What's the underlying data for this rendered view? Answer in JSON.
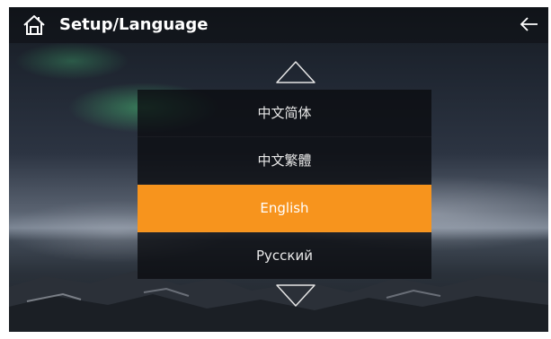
{
  "header": {
    "title": "Setup/Language",
    "home_icon": "home-icon",
    "back_icon": "back-arrow-icon"
  },
  "language_list": {
    "scroll_up_icon": "triangle-up-icon",
    "scroll_down_icon": "triangle-down-icon",
    "items": [
      {
        "label": "中文简体",
        "selected": false
      },
      {
        "label": "中文繁體",
        "selected": false
      },
      {
        "label": "English",
        "selected": true
      },
      {
        "label": "Русский",
        "selected": false
      }
    ]
  },
  "colors": {
    "selected_background": "#f7941d",
    "item_background": "rgba(10,12,16,0.78)",
    "text": "#ffffff"
  }
}
